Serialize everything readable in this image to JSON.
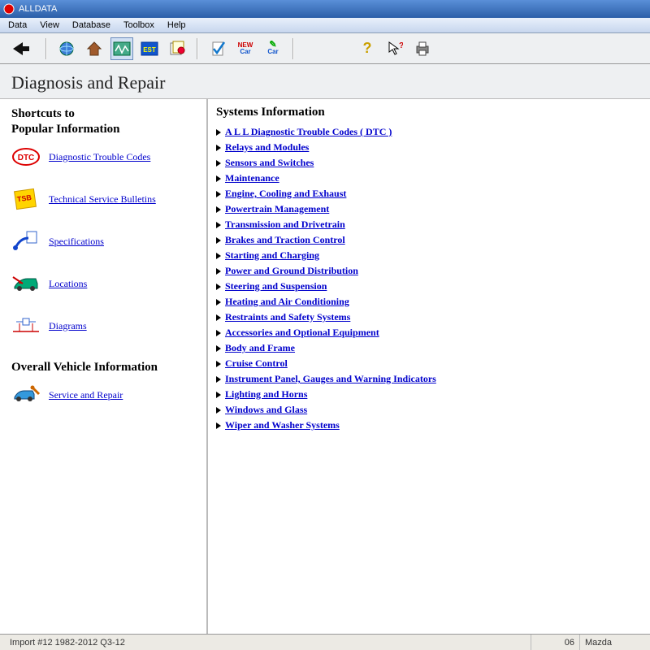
{
  "window": {
    "title": "ALLDATA"
  },
  "menubar": [
    "Data",
    "View",
    "Database",
    "Toolbox",
    "Help"
  ],
  "page": {
    "title": "Diagnosis and Repair"
  },
  "sidebar": {
    "heading1": "Shortcuts to",
    "heading2": "Popular Information",
    "shortcuts": [
      {
        "label": "Diagnostic Trouble Codes",
        "icon": "dtc"
      },
      {
        "label": "Technical Service Bulletins",
        "icon": "tsb"
      },
      {
        "label": "Specifications",
        "icon": "spec"
      },
      {
        "label": "Locations",
        "icon": "loc"
      },
      {
        "label": "Diagrams",
        "icon": "diag"
      }
    ],
    "overall_heading": "Overall Vehicle Information",
    "overall": [
      {
        "label": "Service and Repair",
        "icon": "svcrepair"
      }
    ]
  },
  "systems": {
    "heading": "Systems Information",
    "items": [
      "A L L  Diagnostic Trouble Codes ( DTC )",
      "Relays and Modules",
      "Sensors and Switches",
      "Maintenance",
      "Engine, Cooling and Exhaust",
      "Powertrain Management",
      "Transmission and Drivetrain",
      "Brakes and Traction Control",
      "Starting and Charging",
      "Power and Ground Distribution",
      "Steering and Suspension",
      "Heating and Air Conditioning",
      "Restraints and Safety Systems",
      "Accessories and Optional Equipment",
      "Body and Frame",
      "Cruise Control",
      "Instrument Panel, Gauges and Warning Indicators",
      "Lighting and Horns",
      "Windows and Glass",
      "Wiper and Washer Systems"
    ]
  },
  "statusbar": {
    "left": "Import #12 1982-2012 Q3-12",
    "mid": "06",
    "right": "Mazda"
  }
}
